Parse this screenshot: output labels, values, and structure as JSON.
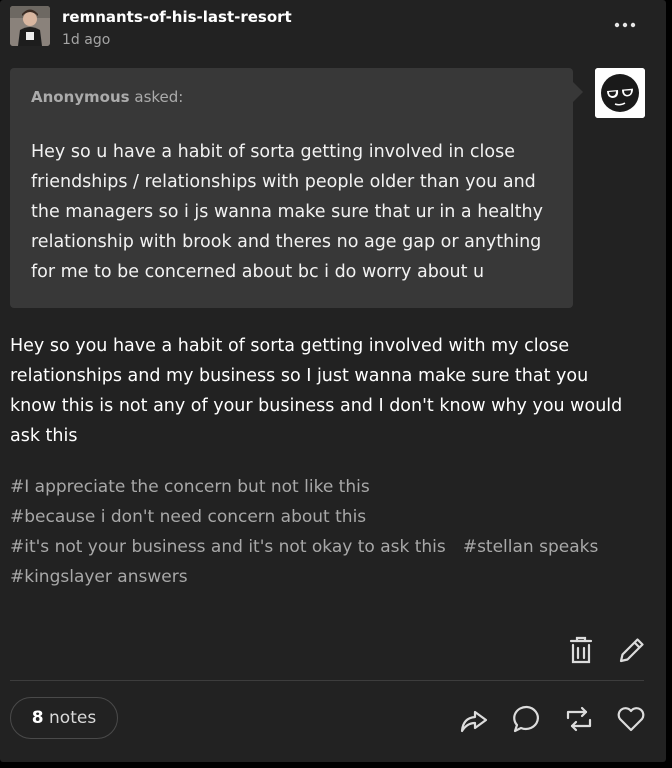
{
  "header": {
    "blog_name": "remnants-of-his-last-resort",
    "timestamp": "1d ago",
    "more_icon": "meatball-menu-icon"
  },
  "ask": {
    "asker": "Anonymous",
    "asked_label": "asked:",
    "question": "Hey so u have a habit of sorta getting involved in close\nfriendships / relationships with people older than you and\nthe managers so i js wanna make sure that ur in a healthy\nrelationship with brook and theres no age gap or anything\nfor me to be concerned about bc i do worry about u",
    "avatar_icon": "sunglasses-face-icon"
  },
  "answer": {
    "text": "Hey so you have a habit of sorta getting involved with my close\nrelationships and my business so I just wanna make sure that you\nknow this is not any of your business and I don't know why you would\nask this"
  },
  "tags": [
    [
      "#I appreciate the concern but not like this"
    ],
    [
      "#because i don't need concern about this"
    ],
    [
      "#it's not your business and it's not okay to ask this",
      "#stellan speaks"
    ],
    [
      "#kingslayer answers"
    ]
  ],
  "actions": {
    "edit_icons": [
      "trash-icon",
      "pencil-icon"
    ],
    "footer_icons": [
      "share-icon",
      "reply-icon",
      "reblog-icon",
      "like-icon"
    ]
  },
  "notes": {
    "count": "8",
    "label": "notes"
  },
  "colors": {
    "post_background": "#222222",
    "ask_background": "#383838",
    "text": "#ffffff",
    "muted_text": "#a8a8a8"
  }
}
